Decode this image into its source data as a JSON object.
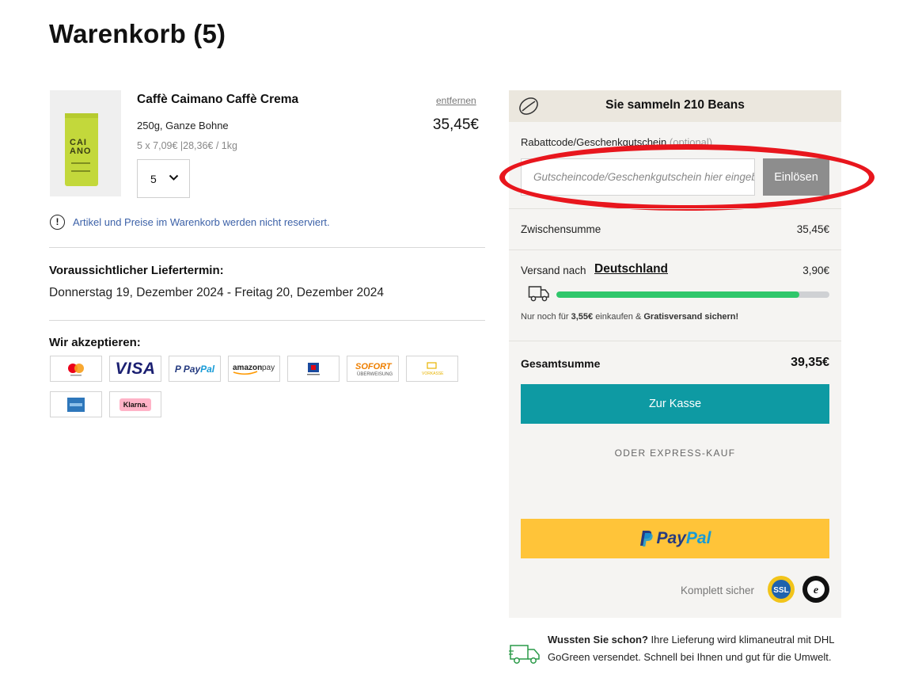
{
  "page": {
    "title": "Warenkorb (5)"
  },
  "cart_item": {
    "name": "Caffè Caimano Caffè Crema",
    "remove_label": "entfernen",
    "variant": "250g, Ganze Bohne",
    "price": "35,45€",
    "unit_info": "5 x 7,09€ |28,36€ / 1kg",
    "quantity": "5",
    "bag_text": "CAI\nMANO"
  },
  "notice": {
    "text": "Artikel und Preise im Warenkorb werden nicht reserviert."
  },
  "delivery": {
    "heading": "Voraussichtlicher Liefertermin:",
    "date_range": "Donnerstag 19, Dezember 2024 - Freitag 20, Dezember 2024"
  },
  "payment_methods": {
    "heading": "Wir akzeptieren:",
    "logos": [
      "Mastercard",
      "VISA",
      "PayPal",
      "amazon pay",
      "EC / Girocard",
      "SOFORT ÜBERWEISUNG",
      "VORKASSE",
      "American Express",
      "Klarna."
    ]
  },
  "summary": {
    "beans_text": "Sie sammeln 210 Beans",
    "coupon_label": "Rabattcode/Geschenkgutschein",
    "coupon_optional": "(optional)",
    "coupon_placeholder": "Gutscheincode/Geschenkgutschein hier eingeben",
    "redeem_label": "Einlösen",
    "subtotal_label": "Zwischensumme",
    "subtotal_value": "35,45€",
    "shipping_label": "Versand nach",
    "shipping_country": "Deutschland",
    "shipping_value": "3,90€",
    "free_shipping_progress": 0.89,
    "free_shipping_hint_pre": "Nur noch für",
    "free_shipping_amount": "3,55€",
    "free_shipping_hint_mid": "einkaufen &",
    "free_shipping_hint_bold": "Gratisversand sichern!",
    "total_label": "Gesamtsumme",
    "total_value": "39,35€",
    "checkout_label": "Zur Kasse",
    "express_label": "ODER EXPRESS-KAUF",
    "paypal_label_a": "Pay",
    "paypal_label_b": "Pal",
    "secure_label": "Komplett sicher",
    "ssl_text": "SSL"
  },
  "green_info": {
    "bold": "Wussten Sie schon?",
    "text": " Ihre Lieferung wird klimaneutral mit DHL GoGreen versendet. Schnell bei Ihnen und gut für die Umwelt."
  },
  "colors": {
    "accent_teal": "#0e9aa3",
    "annotation_red": "#e8161d",
    "progress_green": "#2fc76b",
    "paypal_yellow": "#ffc439"
  }
}
